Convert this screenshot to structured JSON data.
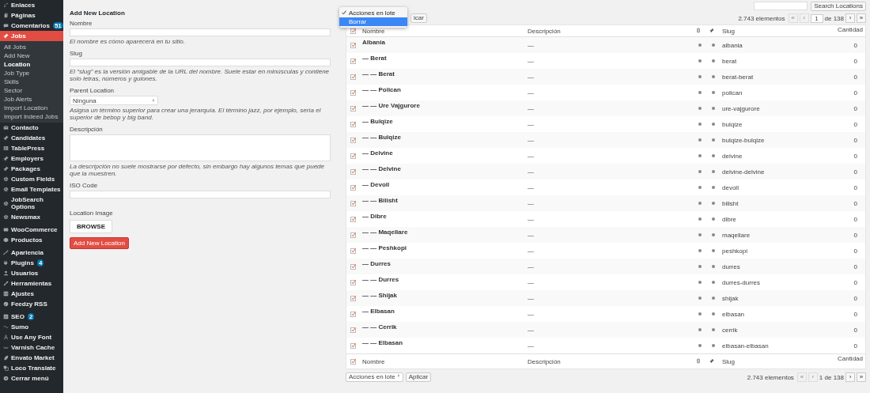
{
  "sidebar": {
    "groups": [
      {
        "items": [
          {
            "label": "Enlaces",
            "selected": false
          },
          {
            "label": "Páginas",
            "selected": false
          },
          {
            "label": "Comentarios",
            "selected": false,
            "badge": "51"
          },
          {
            "label": "Jobs",
            "selected": true,
            "children": [
              {
                "label": "All Jobs",
                "selected": false
              },
              {
                "label": "Add New",
                "selected": false
              },
              {
                "label": "Location",
                "selected": true
              },
              {
                "label": "Job Type",
                "selected": false
              },
              {
                "label": "Skills",
                "selected": false
              },
              {
                "label": "Sector",
                "selected": false
              },
              {
                "label": "Job Alerts",
                "selected": false
              },
              {
                "label": "Import Location",
                "selected": false
              },
              {
                "label": "Import Indeed Jobs",
                "selected": false
              }
            ]
          },
          {
            "label": "Contacto",
            "selected": false
          },
          {
            "label": "Candidates",
            "selected": false
          },
          {
            "label": "TablePress",
            "selected": false
          },
          {
            "label": "Employers",
            "selected": false
          },
          {
            "label": "Packages",
            "selected": false
          },
          {
            "label": "Custom Fields",
            "selected": false
          },
          {
            "label": "Email Templates",
            "selected": false
          },
          {
            "label": "JobSearch Options",
            "selected": false
          },
          {
            "label": "Newsmax",
            "selected": false
          }
        ]
      },
      {
        "items": [
          {
            "label": "WooCommerce",
            "selected": false
          },
          {
            "label": "Productos",
            "selected": false
          }
        ]
      },
      {
        "items": [
          {
            "label": "Apariencia",
            "selected": false
          },
          {
            "label": "Plugins",
            "selected": false,
            "badge": "4"
          },
          {
            "label": "Usuarios",
            "selected": false
          },
          {
            "label": "Herramientas",
            "selected": false
          },
          {
            "label": "Ajustes",
            "selected": false
          },
          {
            "label": "Feedzy RSS",
            "selected": false
          }
        ]
      },
      {
        "items": [
          {
            "label": "SEO",
            "selected": false,
            "badge": "2"
          },
          {
            "label": "Sumo",
            "selected": false
          },
          {
            "label": "Use Any Font",
            "selected": false
          },
          {
            "label": "Varnish Cache",
            "selected": false
          },
          {
            "label": "Envato Market",
            "selected": false
          },
          {
            "label": "Loco Translate",
            "selected": false
          },
          {
            "label": "Cerrar menú",
            "selected": false
          }
        ]
      }
    ]
  },
  "form": {
    "title": "Add New Location",
    "fields": [
      {
        "kind": "text",
        "label": "Nombre",
        "hint": "El nombre es cómo aparecerá en tu sitio."
      },
      {
        "kind": "text",
        "label": "Slug",
        "hint": "El “slug” es la versión amigable de la URL del nombre. Suele estar en minúsculas y contiene solo letras, números y guiones."
      },
      {
        "kind": "select",
        "label": "Parent Location",
        "value": "Ninguna",
        "hint": "Asigna un término superior para crear una jerarquía. El término jazz, por ejemplo, sería el superior de bebop y big band."
      },
      {
        "kind": "textarea",
        "label": "Descripción",
        "hint": "La descripción no suele mostrarse por defecto, sin embargo hay algunos temas que puede que la muestren."
      },
      {
        "kind": "text",
        "label": "ISO Code"
      }
    ],
    "image_label": "Location Image",
    "browse_button": "BROWSE",
    "submit_button": "Add New Location"
  },
  "search": {
    "button": "Search Locations"
  },
  "bulk_top": {
    "menu": [
      {
        "label": "Acciones en lote",
        "checked": true,
        "highlighted": false
      },
      {
        "label": "Borrar",
        "checked": false,
        "highlighted": true
      }
    ],
    "apply_button": "icar"
  },
  "pagination_top": {
    "count": "2.743 elementos",
    "before": [
      {
        "label": "«",
        "disabled": true
      },
      {
        "label": "‹",
        "disabled": true
      }
    ],
    "page": "1",
    "total": "de 138",
    "after": [
      {
        "label": "›",
        "disabled": false
      },
      {
        "label": "»",
        "disabled": false
      }
    ]
  },
  "table": {
    "columns": [
      {
        "kind": "check",
        "checked": true
      },
      {
        "kind": "text",
        "label": "Nombre"
      },
      {
        "kind": "text",
        "label": "Descripción"
      },
      {
        "kind": "icon"
      },
      {
        "kind": "icon"
      },
      {
        "kind": "text",
        "label": "Slug"
      },
      {
        "kind": "count",
        "label": "Cantidad"
      }
    ],
    "rows": [
      {
        "checked": true,
        "name": "Albania",
        "description": "—",
        "slug": "albania",
        "count": "0"
      },
      {
        "checked": true,
        "name": "— Berat",
        "description": "—",
        "slug": "berat",
        "count": "0"
      },
      {
        "checked": true,
        "name": "— — Berat",
        "description": "—",
        "slug": "berat-berat",
        "count": "0"
      },
      {
        "checked": true,
        "name": "— — Polican",
        "description": "—",
        "slug": "polican",
        "count": "0"
      },
      {
        "checked": true,
        "name": "— — Ure Vajgurore",
        "description": "—",
        "slug": "ure-vajgurore",
        "count": "0"
      },
      {
        "checked": true,
        "name": "— Bulqize",
        "description": "—",
        "slug": "bulqize",
        "count": "0"
      },
      {
        "checked": true,
        "name": "— — Bulqize",
        "description": "—",
        "slug": "bulqize-bulqize",
        "count": "0"
      },
      {
        "checked": true,
        "name": "— Delvine",
        "description": "—",
        "slug": "delvine",
        "count": "0"
      },
      {
        "checked": true,
        "name": "— — Delvine",
        "description": "—",
        "slug": "delvine-delvine",
        "count": "0"
      },
      {
        "checked": true,
        "name": "— Devoll",
        "description": "—",
        "slug": "devoll",
        "count": "0"
      },
      {
        "checked": true,
        "name": "— — Bilisht",
        "description": "—",
        "slug": "bilisht",
        "count": "0"
      },
      {
        "checked": true,
        "name": "— Dibre",
        "description": "—",
        "slug": "dibre",
        "count": "0"
      },
      {
        "checked": true,
        "name": "— — Maqellare",
        "description": "—",
        "slug": "maqellare",
        "count": "0"
      },
      {
        "checked": true,
        "name": "— — Peshkopi",
        "description": "—",
        "slug": "peshkopi",
        "count": "0"
      },
      {
        "checked": true,
        "name": "— Durres",
        "description": "—",
        "slug": "durres",
        "count": "0"
      },
      {
        "checked": true,
        "name": "— — Durres",
        "description": "—",
        "slug": "durres-durres",
        "count": "0"
      },
      {
        "checked": true,
        "name": "— — Shijak",
        "description": "—",
        "slug": "shijak",
        "count": "0"
      },
      {
        "checked": true,
        "name": "— Elbasan",
        "description": "—",
        "slug": "elbasan",
        "count": "0"
      },
      {
        "checked": true,
        "name": "— — Cerrik",
        "description": "—",
        "slug": "cerrik",
        "count": "0"
      },
      {
        "checked": true,
        "name": "— — Elbasan",
        "description": "—",
        "slug": "elbasan-elbasan",
        "count": "0"
      }
    ],
    "footer_columns": [
      {
        "kind": "check",
        "checked": true
      },
      {
        "kind": "text",
        "label": "Nombre"
      },
      {
        "kind": "text",
        "label": "Descripción"
      },
      {
        "kind": "icon"
      },
      {
        "kind": "icon"
      },
      {
        "kind": "text",
        "label": "Slug"
      },
      {
        "kind": "count",
        "label": "Cantidad"
      }
    ]
  },
  "bulk_bottom": {
    "value": "Acciones en lote",
    "apply_button": "Aplicar"
  },
  "pagination_bottom": {
    "count": "2.743 elementos",
    "before": [
      {
        "label": "«",
        "disabled": true
      },
      {
        "label": "‹",
        "disabled": true
      }
    ],
    "page_text": "1 de 138",
    "after": [
      {
        "label": "›",
        "disabled": false
      },
      {
        "label": "»",
        "disabled": false
      }
    ]
  }
}
